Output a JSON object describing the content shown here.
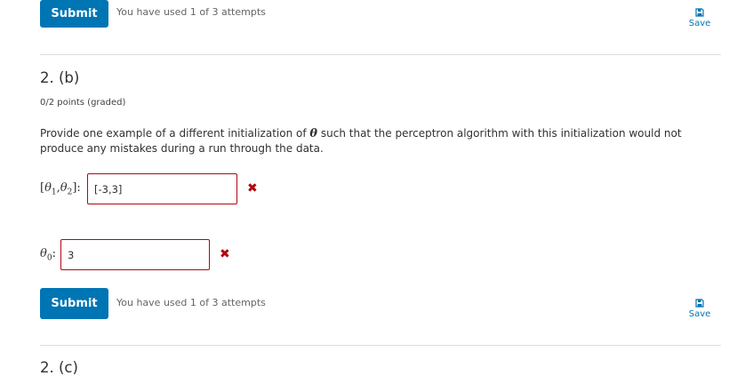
{
  "top": {
    "submit_label": "Submit",
    "attempts_text": "You have used 1 of 3 attempts",
    "save_label": "Save"
  },
  "problem": {
    "title": "2. (b)",
    "points": "0/2 points (graded)",
    "prompt_before": "Provide one example of a different initialization of ",
    "prompt_symbol": "θ",
    "prompt_after": " such that the perceptron algorithm with this initialization would not produce any mistakes during a run through the data.",
    "field1": {
      "label_open": "[",
      "label_var": "θ",
      "sub1": "1",
      "comma": ",",
      "sub2": "2",
      "label_close": "]:",
      "value": "[-3,3]"
    },
    "field2": {
      "label_var": "θ",
      "sub": "0",
      "label_close": ":",
      "value": "3"
    },
    "incorrect_icon": "✖",
    "submit_label": "Submit",
    "attempts_text": "You have used 1 of 3 attempts",
    "save_label": "Save"
  },
  "next_problem": {
    "title": "2. (c)"
  },
  "colors": {
    "accent": "#0075b4",
    "error": "#b20610"
  }
}
